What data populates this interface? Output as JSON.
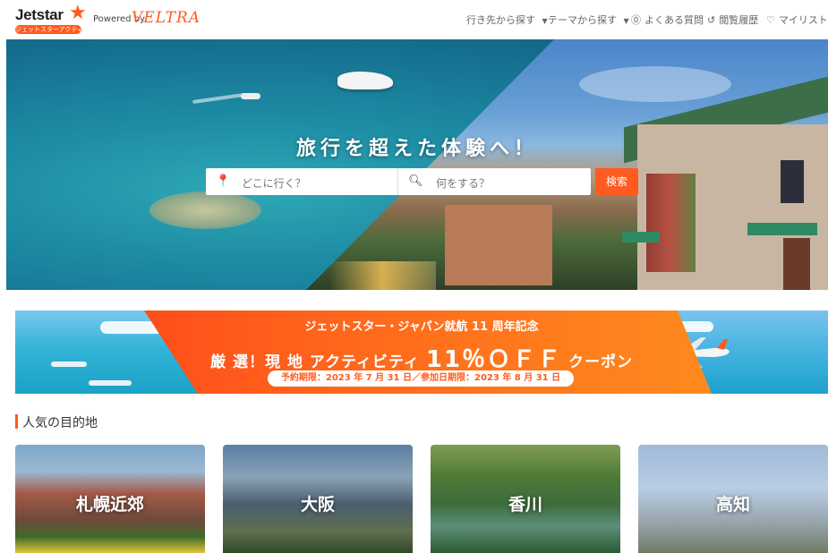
{
  "header": {
    "logo_word": "Jetstar",
    "logo_sub": "ジェットスターアクティビティ",
    "powered_by": "Powered by",
    "partner": "VELTRA",
    "nav": [
      {
        "label": "行き先から探す",
        "icon": "chevron-down-icon"
      },
      {
        "label": "テーマから探す",
        "icon": "chevron-down-icon"
      },
      {
        "label": "よくある質問",
        "icon": "help-circle-icon"
      },
      {
        "label": "閲覧履歴",
        "icon": "history-icon"
      },
      {
        "label": "マイリスト",
        "icon": "heart-icon"
      }
    ]
  },
  "hero": {
    "title": "旅行を超えた体験へ！",
    "where_placeholder": "どこに行く？",
    "what_placeholder": "何をする？",
    "search_button": "検索"
  },
  "banner": {
    "line1": "ジェットスター・ジャパン就航 11 周年記念",
    "line2_prefix": "厳 選！現 地 アクティビティ",
    "line2_big": "11％ＯＦＦ",
    "line2_suffix": "クーポン",
    "period": "予約期限：2023 年 7 月 31 日／参加日期限：2023 年 8 月 31 日"
  },
  "destinations": {
    "title": "人気の目的地",
    "items": [
      {
        "label": "札幌近郊"
      },
      {
        "label": "大阪"
      },
      {
        "label": "香川"
      },
      {
        "label": "高知"
      }
    ]
  },
  "colors": {
    "brand": "#ff5a1f",
    "text": "#333333"
  }
}
